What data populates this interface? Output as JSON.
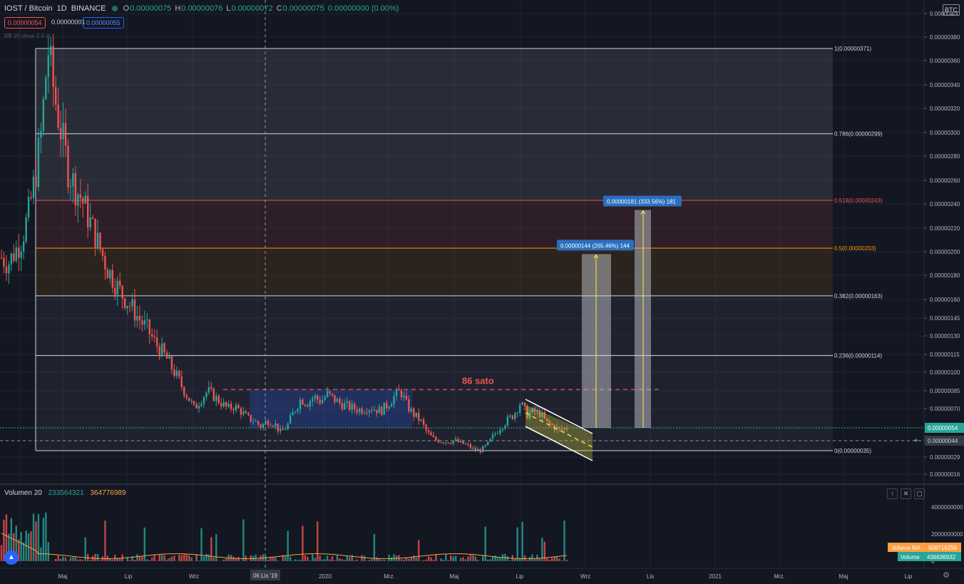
{
  "header": {
    "symbol": "IOST / Bitcoin",
    "interval": "1D",
    "exchange": "BINANCE",
    "o_label": "O",
    "o": "0.00000075",
    "h_label": "H",
    "h": "0.00000076",
    "l_label": "L",
    "l": "0.00000072",
    "c_label": "C",
    "c": "0.00000075",
    "change": "0.00000000 (0.00%)",
    "bid": "0.00000054",
    "spread": "0.00000001",
    "ask": "0.00000055",
    "indicator": "BB 20 close 2 0"
  },
  "currency_button": "BTC",
  "price_axis": {
    "labels": [
      "0.00000400",
      "0.00000380",
      "0.00000360",
      "0.00000340",
      "0.00000320",
      "0.00000300",
      "0.00000280",
      "0.00000260",
      "0.00000240",
      "0.00000220",
      "0.00000200",
      "0.00000180",
      "0.00000160",
      "0.00000145",
      "0.00000130",
      "0.00000115",
      "0.00000100",
      "0.00000085",
      "0.00000070",
      "0.00000054",
      "0.00000044",
      "0.00000029",
      "0.00000016"
    ],
    "last_price_tag": "0.00000054",
    "crosshair_tag": "0.00000044"
  },
  "time_axis": {
    "labels": [
      "Maj",
      "Lip",
      "Wrz",
      "2020",
      "Mrz.",
      "Maj",
      "Lip",
      "Wrz",
      "Lis",
      "2021",
      "Mrz.",
      "Maj",
      "Lip"
    ],
    "crosshair_tag": "06 Lis '19"
  },
  "chart_data": {
    "type": "candlestick",
    "series": "IOST/BTC 1D",
    "price_range_btc": [
      1e-07,
      4e-06
    ],
    "price_path_btc": [
      1.95e-06,
      1.9e-06,
      2e-06,
      2.1e-06,
      2.3e-06,
      2.6e-06,
      3e-06,
      3.71e-06,
      3.3e-06,
      3e-06,
      2.7e-06,
      2.55e-06,
      2.45e-06,
      2.3e-06,
      2.15e-06,
      2e-06,
      1.85e-06,
      1.75e-06,
      1.65e-06,
      1.58e-06,
      1.5e-06,
      1.42e-06,
      1.35e-06,
      1.25e-06,
      1.18e-06,
      1.1e-06,
      1e-06,
      9e-07,
      8e-07,
      7e-07,
      7.8e-07,
      8.5e-07,
      8e-07,
      7.5e-07,
      7e-07,
      7.2e-07,
      6.8e-07,
      6.2e-07,
      6e-07,
      5.5e-07,
      6e-07,
      5.8e-07,
      5e-07,
      5.6e-07,
      6.8e-07,
      7.8e-07,
      7.5e-07,
      8e-07,
      7.6e-07,
      8.2e-07,
      7.8e-07,
      7.4e-07,
      7.2e-07,
      7e-07,
      6.9e-07,
      7.1e-07,
      7e-07,
      6.8e-07,
      7.3e-07,
      8e-07,
      8.5e-07,
      7.2e-07,
      6.5e-07,
      6e-07,
      5e-07,
      4.5e-07,
      4.4e-07,
      4.3e-07,
      4.4e-07,
      4.2e-07,
      4e-07,
      3.6e-07,
      3.5e-07,
      4e-07,
      4.8e-07,
      5.5e-07,
      6e-07,
      6.5e-07,
      7.5e-07,
      6.5e-07,
      6.8e-07,
      6.6e-07,
      5.8e-07,
      5.5e-07,
      5.2e-07,
      5.4e-07
    ],
    "fibonacci": [
      {
        "label": "1(0.00000371)",
        "price": 3.71e-06,
        "color": "#d1d4dc"
      },
      {
        "label": "0.786(0.00000299)",
        "price": 2.99e-06,
        "color": "#d1d4dc"
      },
      {
        "label": "0.618(0.00000243)",
        "price": 2.43e-06,
        "color": "#ef5350"
      },
      {
        "label": "0.5(0.00000203)",
        "price": 2.03e-06,
        "color": "#ff9800"
      },
      {
        "label": "0.382(0.00000163)",
        "price": 1.63e-06,
        "color": "#d1d4dc"
      },
      {
        "label": "0.236(0.00000114)",
        "price": 1.14e-06,
        "color": "#d1d4dc"
      },
      {
        "label": "0(0.00000035)",
        "price": 3.5e-07,
        "color": "#d1d4dc"
      }
    ],
    "resistance_label": "86 sato",
    "resistance_price": 8.6e-07,
    "targets": [
      {
        "label": "0.00000144 (265.46%) 144",
        "from": 5.4e-07,
        "to": 1.98e-06
      },
      {
        "label": "0.00000181 (333.56%) 181",
        "from": 5.4e-07,
        "to": 2.35e-06
      }
    ],
    "volume": {
      "label": "Volumen 20",
      "value_1": "233564321",
      "value_2": "364776989",
      "axis_labels": [
        "4000000000",
        "2000000000",
        "0"
      ],
      "ma_tag_label": "Volume MA",
      "ma_tag_value": "508716256",
      "vol_tag_label": "Volume",
      "vol_tag_value": "436636932"
    }
  }
}
